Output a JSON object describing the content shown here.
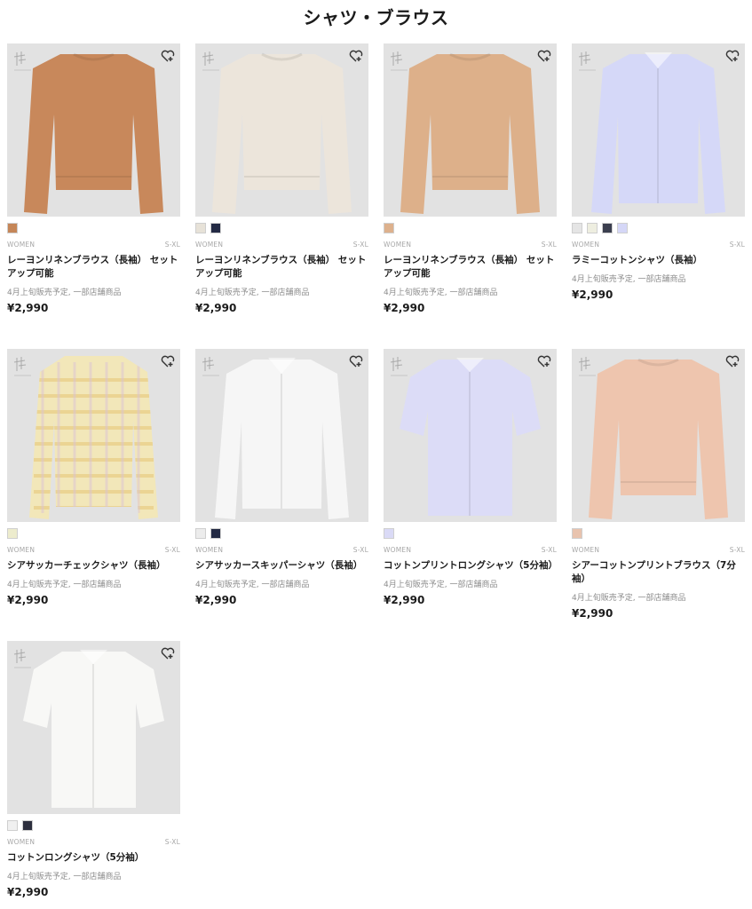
{
  "page_title": "シャツ・ブラウス",
  "products": [
    {
      "name": "レーヨンリネンブラウス（長袖） セットアップ可能",
      "gender": "WOMEN",
      "size": "S-XL",
      "note": "4月上旬販売予定, 一部店舗商品",
      "price": "¥2,990",
      "swatches": [
        "#c58658"
      ],
      "garment_color": "#c8885b",
      "garment": "blouse",
      "logo": "brand-logo",
      "icon": "heart-plus-icon"
    },
    {
      "name": "レーヨンリネンブラウス（長袖） セットアップ可能",
      "gender": "WOMEN",
      "size": "S-XL",
      "note": "4月上旬販売予定, 一部店舗商品",
      "price": "¥2,990",
      "swatches": [
        "#e7e2d8",
        "#232a44"
      ],
      "garment_color": "#ece5db",
      "garment": "blouse",
      "logo": "brand-logo",
      "icon": "heart-plus-icon"
    },
    {
      "name": "レーヨンリネンブラウス（長袖） セットアップ可能",
      "gender": "WOMEN",
      "size": "S-XL",
      "note": "4月上旬販売予定, 一部店舗商品",
      "price": "¥2,990",
      "swatches": [
        "#ddb18d"
      ],
      "garment_color": "#ddb08a",
      "garment": "blouse",
      "logo": "brand-logo",
      "icon": "heart-plus-icon"
    },
    {
      "name": "ラミーコットンシャツ（長袖）",
      "gender": "WOMEN",
      "size": "S-XL",
      "note": "4月上旬販売予定, 一部店舗商品",
      "price": "¥2,990",
      "swatches": [
        "#e5e5e5",
        "#eeeee0",
        "#3b3f4f",
        "#d5d7f7"
      ],
      "garment_color": "#d5d8f8",
      "garment": "shirt",
      "logo": "brand-logo",
      "icon": "heart-plus-icon"
    },
    {
      "name": "シアサッカーチェックシャツ（長袖）",
      "gender": "WOMEN",
      "size": "S-XL",
      "note": "4月上旬販売予定, 一部店舗商品",
      "price": "¥2,990",
      "swatches": [
        "#edeccd"
      ],
      "garment_color": "#f2e7b9",
      "garment": "check-shirt",
      "logo": "brand-logo",
      "icon": "heart-plus-icon"
    },
    {
      "name": "シアサッカースキッパーシャツ（長袖）",
      "gender": "WOMEN",
      "size": "S-XL",
      "note": "4月上旬販売予定, 一部店舗商品",
      "price": "¥2,990",
      "swatches": [
        "#ececec",
        "#232a44"
      ],
      "garment_color": "#f6f6f6",
      "garment": "shirt",
      "logo": "brand-logo",
      "icon": "heart-plus-icon"
    },
    {
      "name": "コットンプリントロングシャツ（5分袖）",
      "gender": "WOMEN",
      "size": "S-XL",
      "note": "4月上旬販売予定, 一部店舗商品",
      "price": "¥2,990",
      "swatches": [
        "#dadaf6"
      ],
      "garment_color": "#dcdcf7",
      "garment": "short-shirt",
      "logo": "brand-logo",
      "icon": "heart-plus-icon"
    },
    {
      "name": "シアーコットンプリントブラウス（7分袖）",
      "gender": "WOMEN",
      "size": "S-XL",
      "note": "4月上旬販売予定, 一部店舗商品",
      "price": "¥2,990",
      "swatches": [
        "#e8c3ae"
      ],
      "garment_color": "#eec5ae",
      "garment": "blouse",
      "logo": "brand-logo",
      "icon": "heart-plus-icon"
    },
    {
      "name": "コットンロングシャツ（5分袖）",
      "gender": "WOMEN",
      "size": "S-XL",
      "note": "4月上旬販売予定, 一部店舗商品",
      "price": "¥2,990",
      "swatches": [
        "#f0f0f0",
        "#2d2f3e"
      ],
      "garment_color": "#f8f8f6",
      "garment": "short-shirt",
      "logo": "brand-logo",
      "icon": "heart-plus-icon"
    }
  ]
}
